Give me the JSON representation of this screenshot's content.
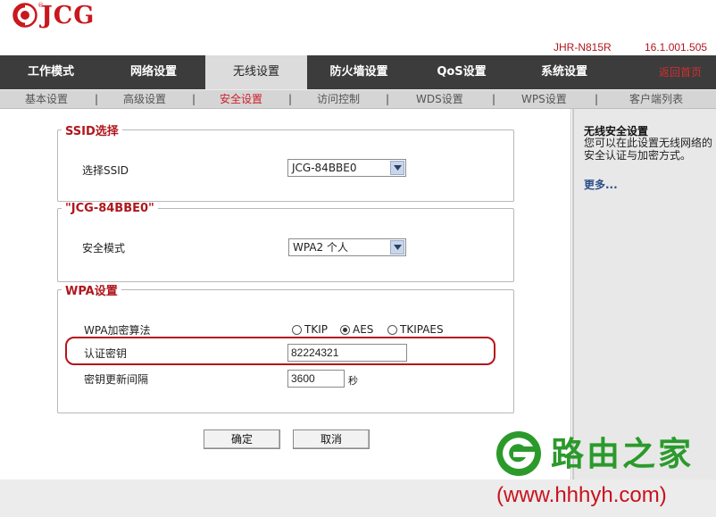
{
  "brand": {
    "name": "JCG",
    "reg": "®"
  },
  "device": {
    "model": "JHR-N815R",
    "version": "16.1.001.505"
  },
  "main_nav": {
    "tabs": [
      {
        "label": "工作模式"
      },
      {
        "label": "网络设置"
      },
      {
        "label": "无线设置",
        "active": true
      },
      {
        "label": "防火墙设置"
      },
      {
        "label": "QoS设置"
      },
      {
        "label": "系统设置"
      }
    ],
    "logout": "返回首页"
  },
  "sub_nav": {
    "items": [
      {
        "label": "基本设置"
      },
      {
        "label": "高级设置"
      },
      {
        "label": "安全设置",
        "active": true
      },
      {
        "label": "访问控制"
      },
      {
        "label": "WDS设置"
      },
      {
        "label": "WPS设置"
      },
      {
        "label": "客户端列表"
      }
    ],
    "separator": "|"
  },
  "ssid_section": {
    "legend": "SSID选择",
    "label": "选择SSID",
    "value": "JCG-84BBE0"
  },
  "security_section": {
    "legend": "\"JCG-84BBE0\"",
    "label": "安全模式",
    "value": "WPA2 个人"
  },
  "wpa_section": {
    "legend": "WPA设置",
    "algo_label": "WPA加密算法",
    "algo_options": [
      {
        "label": "TKIP",
        "selected": false
      },
      {
        "label": "AES",
        "selected": true
      },
      {
        "label": "TKIPAES",
        "selected": false
      }
    ],
    "key_label": "认证密钥",
    "key_value": "82224321",
    "interval_label": "密钥更新间隔",
    "interval_value": "3600",
    "interval_unit": "秒"
  },
  "buttons": {
    "ok": "确定",
    "cancel": "取消"
  },
  "sidebar": {
    "title": "无线安全设置",
    "description": "您可以在此设置无线网络的安全认证与加密方式。",
    "more": "更多..."
  },
  "watermark": {
    "text": "路由之家",
    "url": "(www.hhhyh.com)"
  },
  "colors": {
    "accent_red": "#b0171d",
    "nav_dark": "#3c3c3c",
    "watermark_green": "#2b9a2b"
  }
}
